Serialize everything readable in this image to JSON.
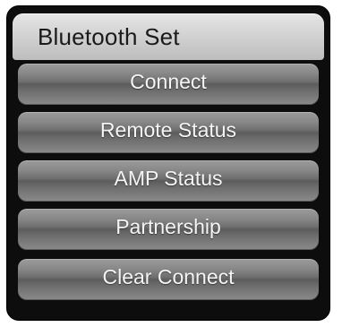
{
  "window": {
    "title": "Bluetooth Set"
  },
  "menu": {
    "items": [
      {
        "label": "Connect"
      },
      {
        "label": "Remote Status"
      },
      {
        "label": "AMP Status"
      },
      {
        "label": "Partnership"
      },
      {
        "label": "Clear Connect"
      }
    ]
  },
  "colors": {
    "background": "#0d0d0d",
    "title_bar": "#d0d0d0",
    "button": "#7a7a7a",
    "button_text": "#f5f5f5",
    "title_text": "#1a1a1a"
  }
}
